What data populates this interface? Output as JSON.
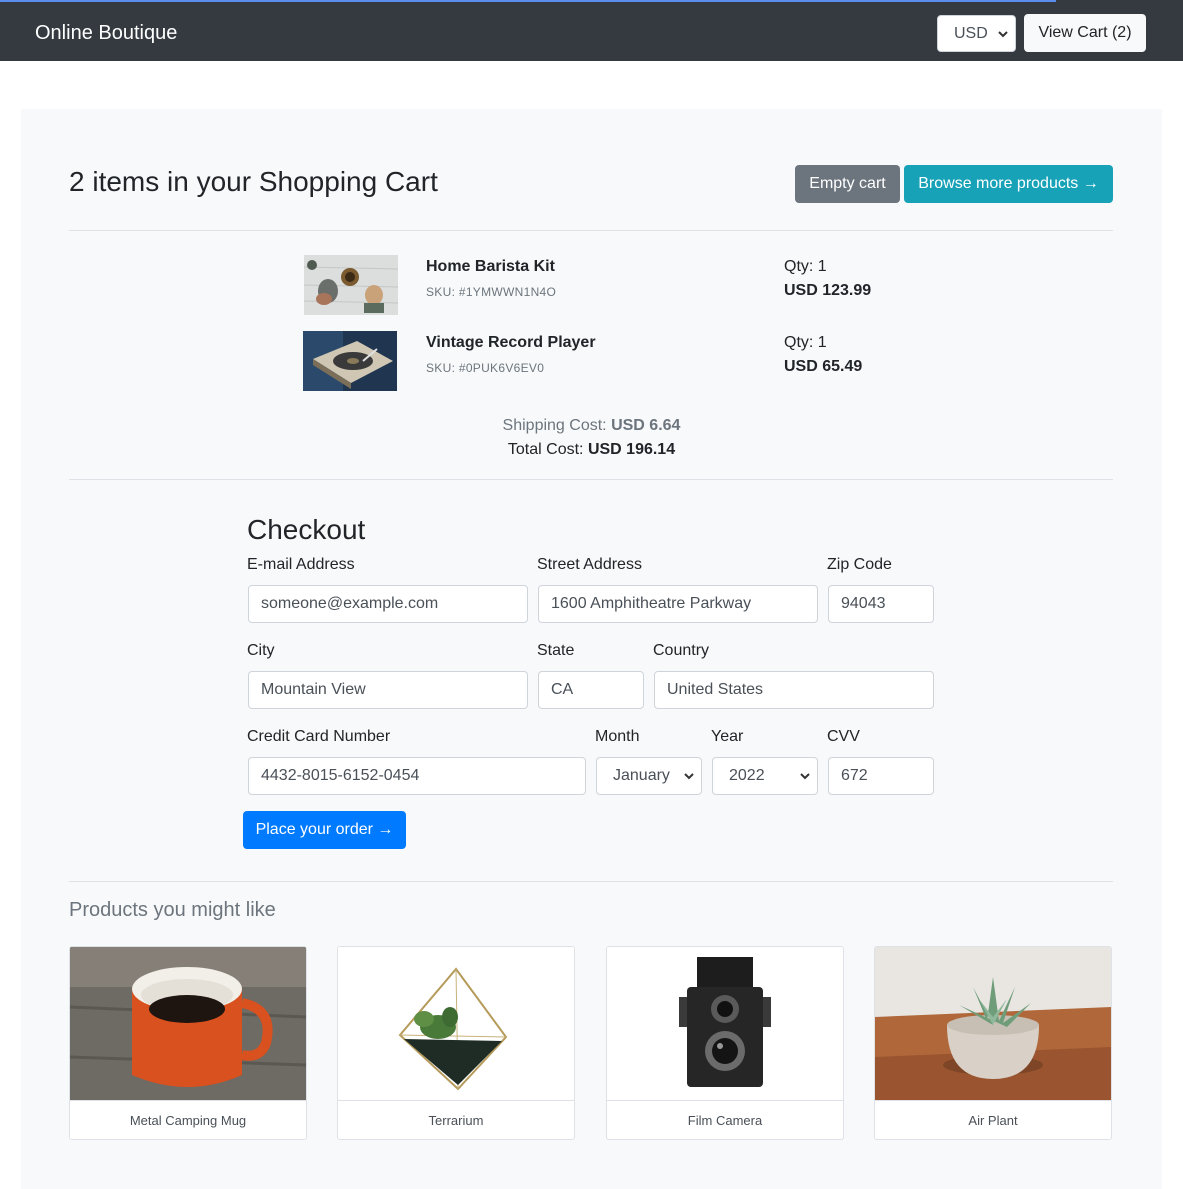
{
  "navbar": {
    "brand": "Online Boutique",
    "currency": "USD",
    "view_cart_label": "View Cart (2)"
  },
  "cart": {
    "title": "2 items in your Shopping Cart",
    "empty_label": "Empty cart",
    "browse_label": "Browse more products →",
    "items": [
      {
        "name": "Home Barista Kit",
        "sku": "SKU: #1YMWWN1N4O",
        "qty": "Qty: 1",
        "price": "USD 123.99"
      },
      {
        "name": "Vintage Record Player",
        "sku": "SKU: #0PUK6V6EV0",
        "qty": "Qty: 1",
        "price": "USD 65.49"
      }
    ],
    "shipping_label": "Shipping Cost:",
    "shipping_value": "USD 6.64",
    "total_label": "Total Cost:",
    "total_value": "USD 196.14"
  },
  "checkout": {
    "title": "Checkout",
    "email_label": "E-mail Address",
    "email_value": "someone@example.com",
    "street_label": "Street Address",
    "street_value": "1600 Amphitheatre Parkway",
    "zip_label": "Zip Code",
    "zip_value": "94043",
    "city_label": "City",
    "city_value": "Mountain View",
    "state_label": "State",
    "state_value": "CA",
    "country_label": "Country",
    "country_value": "United States",
    "cc_label": "Credit Card Number",
    "cc_value": "4432-8015-6152-0454",
    "month_label": "Month",
    "month_value": "January",
    "year_label": "Year",
    "year_value": "2022",
    "cvv_label": "CVV",
    "cvv_value": "672",
    "order_label": "Place your order →"
  },
  "recommendations": {
    "title": "Products you might like",
    "items": [
      {
        "name": "Metal Camping Mug"
      },
      {
        "name": "Terrarium"
      },
      {
        "name": "Film Camera"
      },
      {
        "name": "Air Plant"
      }
    ]
  },
  "colors": {
    "navbar": "#343a40",
    "panel": "#f8f9fa",
    "secondary_button": "#6c757d",
    "info_button": "#17a2b8",
    "primary_button": "#007bff"
  }
}
